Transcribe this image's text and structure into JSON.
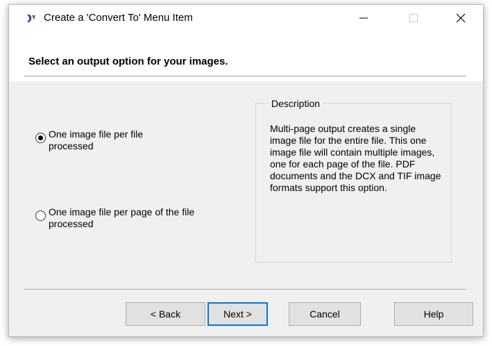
{
  "window": {
    "title": "Create a 'Convert To' Menu Item"
  },
  "header": {
    "instruction": "Select an output option for your images."
  },
  "options": [
    {
      "label": "One image file per file processed",
      "selected": true
    },
    {
      "label": "One image file per page of the file processed",
      "selected": false
    }
  ],
  "description": {
    "legend": "Description",
    "text": "Multi-page output creates a single image file for the entire file.  This one image file will contain multiple images, one for each page of the file.  PDF documents and the DCX and TIF image formats support this option."
  },
  "buttons": {
    "back": "< Back",
    "next": "Next >",
    "cancel": "Cancel",
    "help": "Help"
  },
  "icons": {
    "app": "app-icon",
    "minimize": "minimize-icon",
    "maximize": "maximize-icon",
    "close": "close-icon"
  },
  "colors": {
    "default_button_border": "#0078d7",
    "window_background": "#f0f0f0"
  }
}
